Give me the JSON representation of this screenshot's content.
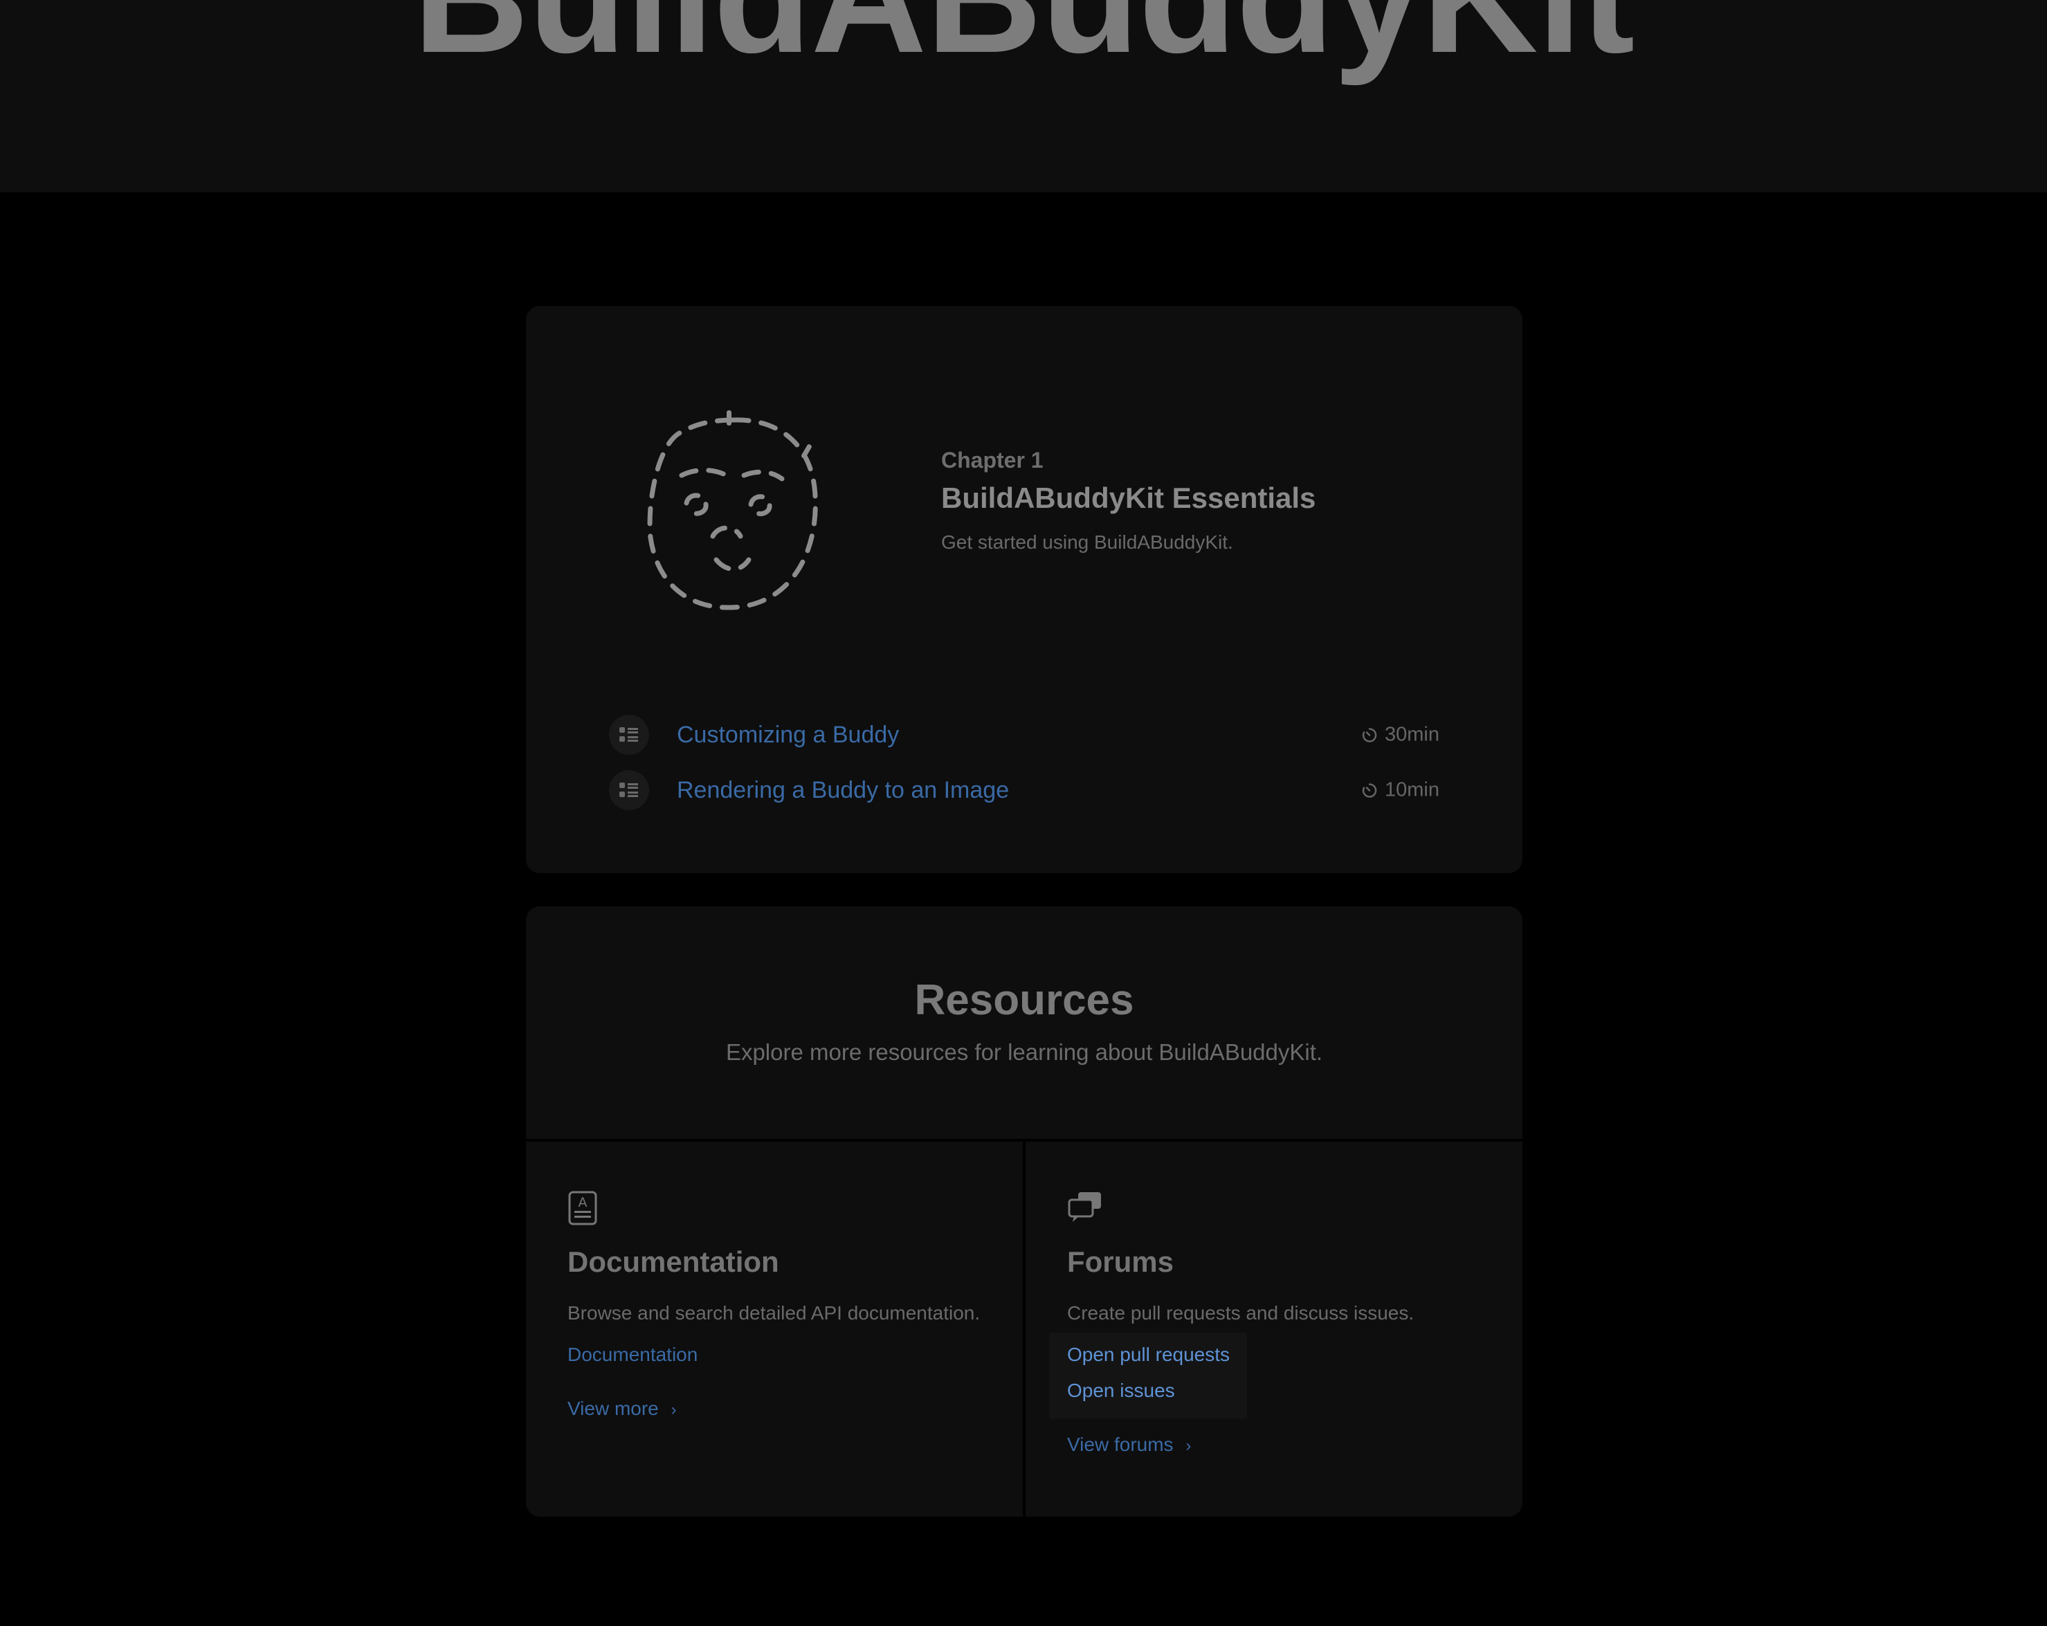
{
  "hero": {
    "title": "BuildABuddyKit"
  },
  "chapter": {
    "number": "Chapter 1",
    "title": "BuildABuddyKit Essentials",
    "subtitle": "Get started using BuildABuddyKit.",
    "tutorials": [
      {
        "title": "Customizing a Buddy",
        "duration": "30min"
      },
      {
        "title": "Rendering a Buddy to an Image",
        "duration": "10min"
      }
    ]
  },
  "resources": {
    "title": "Resources",
    "subtitle": "Explore more resources for learning about BuildABuddyKit.",
    "documentation": {
      "title": "Documentation",
      "description": "Browse and search detailed API documentation.",
      "link": "Documentation",
      "more": "View more"
    },
    "forums": {
      "title": "Forums",
      "description": "Create pull requests and discuss issues.",
      "links": [
        "Open pull requests",
        "Open issues"
      ],
      "more": "View forums"
    }
  }
}
